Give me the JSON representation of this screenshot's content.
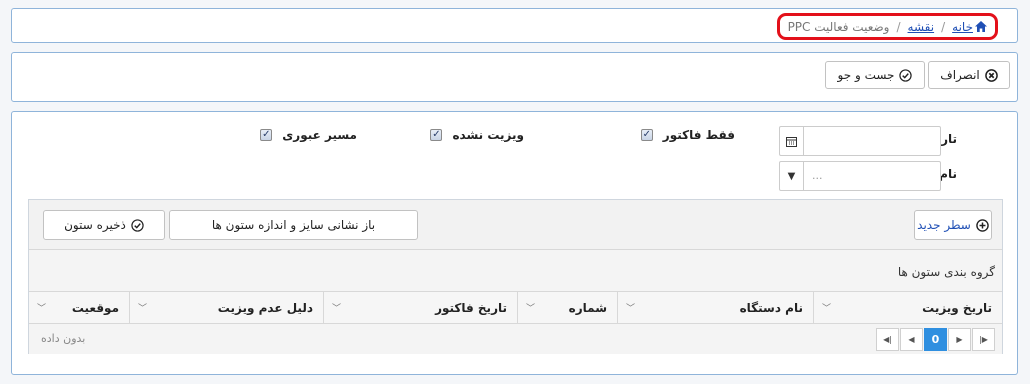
{
  "breadcrumb": {
    "home": "خانه",
    "map": "نقشه",
    "current": "وضعیت فعالیت PPC",
    "sep": "/"
  },
  "toolbar": {
    "cancel_label": "انصراف",
    "search_label": "جست و جو"
  },
  "filters": {
    "date_label": "تاریخ",
    "device_label": "نام دستگاه",
    "device_placeholder": "...",
    "checkboxes": [
      {
        "label": "فقط فاکتور",
        "checked": true
      },
      {
        "label": "ویزیت نشده",
        "checked": true
      },
      {
        "label": "مسیر عبوری",
        "checked": true
      }
    ]
  },
  "grid": {
    "new_row_label": "سطر جدید",
    "reset_columns_label": "باز نشانی سایز و اندازه ستون ها",
    "save_columns_label": "ذخیره ستون",
    "group_label": "گروه بندی ستون ها",
    "columns": [
      "تاریخ ویزیت",
      "نام دستگاه",
      "شماره",
      "تاریخ فاکتور",
      "دلیل عدم ویزیت",
      "موقعیت"
    ],
    "empty_text": "بدون داده",
    "current_page": "0"
  },
  "colors": {
    "accent": "#2f8fe0",
    "highlight": "#e3101a",
    "link": "#1f4fb5",
    "panel_border": "#8fb4da"
  }
}
